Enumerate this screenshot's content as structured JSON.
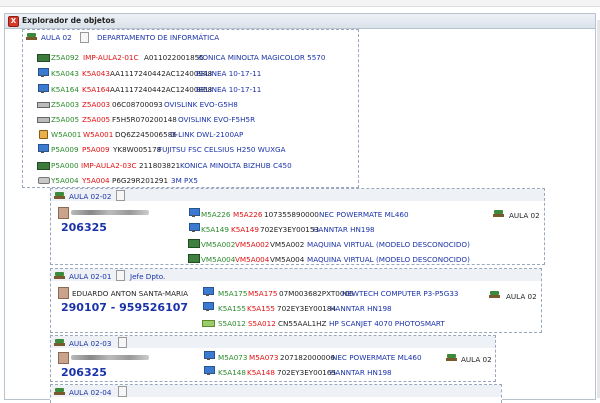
{
  "window": {
    "title": "Explorador de objetos",
    "close_label": "X"
  },
  "aula02": {
    "label": "AULA 02",
    "department": "DEPARTAMENTO DE INFORMÁTICA",
    "rows": [
      {
        "icon": "printer-icon",
        "code": "Z5A092",
        "loc": "IMP-AULA2-01C",
        "serial": "A011022001855",
        "model": "KONICA MINOLTA MAGICOLOR 5570"
      },
      {
        "icon": "monitor-icon",
        "code": "K5A043",
        "loc": "K5A043",
        "serial": "AA1117240442AC12400948",
        "model": "BELINEA 10-17-11"
      },
      {
        "icon": "monitor-icon",
        "code": "K5A164",
        "loc": "K5A164",
        "serial": "AA1117240442AC12400868",
        "model": "BELINEA 10-17-11"
      },
      {
        "icon": "switch-icon",
        "code": "Z5A003",
        "loc": "Z5A003",
        "serial": "06C08700093",
        "model": "OVISLINK EVO-G5H8"
      },
      {
        "icon": "switch-icon",
        "code": "Z5A005",
        "loc": "Z5A005",
        "serial": "F5H5R070200148",
        "model": "OVISLINK EVO-F5H5R"
      },
      {
        "icon": "access-point-icon",
        "code": "W5A001",
        "loc": "W5A001",
        "serial": "DQ6Z245006586",
        "model": "D-LINK DWL-2100AP"
      },
      {
        "icon": "monitor-icon",
        "code": "P5A009",
        "loc": "P5A009",
        "serial": "YK8W005178",
        "model": "FUJITSU FSC CELSIUS H250 WUXGA"
      },
      {
        "icon": "printer-icon",
        "code": "P5A000",
        "loc": "IMP-AULA2-03C",
        "serial": "211803821",
        "model": "KONICA MINOLTA BIZHUB C450"
      },
      {
        "icon": "projector-icon",
        "code": "Y5A004",
        "loc": "Y5A004",
        "serial": "P6G29R201291",
        "model": "3M PX5"
      }
    ]
  },
  "aula0202": {
    "label": "AULA 02-02",
    "number": "206325",
    "room_tag": "AULA 02",
    "rows": [
      {
        "code": "M5A226",
        "loc": "M5A226",
        "serial": "107355890000",
        "model": "NEC POWERMATE ML460"
      },
      {
        "code": "K5A149",
        "loc": "K5A149",
        "serial": "702EY3EY00153",
        "model": "HANNTAR HN198"
      },
      {
        "code": "VM5A002",
        "loc": "VM5A002",
        "serial": "VM5A002",
        "model": "MAQUINA VIRTUAL (MODELO DESCONOCIDO)"
      },
      {
        "code": "VM5A004",
        "loc": "VM5A004",
        "serial": "VM5A004",
        "model": "MAQUINA VIRTUAL (MODELO DESCONOCIDO)"
      }
    ]
  },
  "aula0201": {
    "label": "AULA 02-01",
    "role": "Jefe Dpto.",
    "person": "EDUARDO ANTON SANTA-MARIA",
    "number": "290107 - 959526107",
    "room_tag": "AULA 02",
    "rows": [
      {
        "code": "M5A175",
        "loc": "M5A175",
        "serial": "07M003682PXT0006",
        "model": "NEWTECH COMPUTER P3-P5G33"
      },
      {
        "code": "K5A155",
        "loc": "K5A155",
        "serial": "702EY3EY00184",
        "model": "HANNTAR HN198"
      },
      {
        "code": "S5A012",
        "loc": "S5A012",
        "serial": "CN55AAL1HZ",
        "model": "HP SCANJET 4070 PHOTOSMART"
      }
    ]
  },
  "aula0203": {
    "label": "AULA 02-03",
    "number": "206325",
    "room_tag": "AULA 02",
    "rows": [
      {
        "code": "M5A073",
        "loc": "M5A073",
        "serial": "207182000006",
        "model": "NEC POWERMATE ML460"
      },
      {
        "code": "K5A148",
        "loc": "K5A148",
        "serial": "702EY3EY00165",
        "model": "HANNTAR HN198"
      }
    ]
  },
  "aula0204": {
    "label": "AULA 02-04"
  }
}
